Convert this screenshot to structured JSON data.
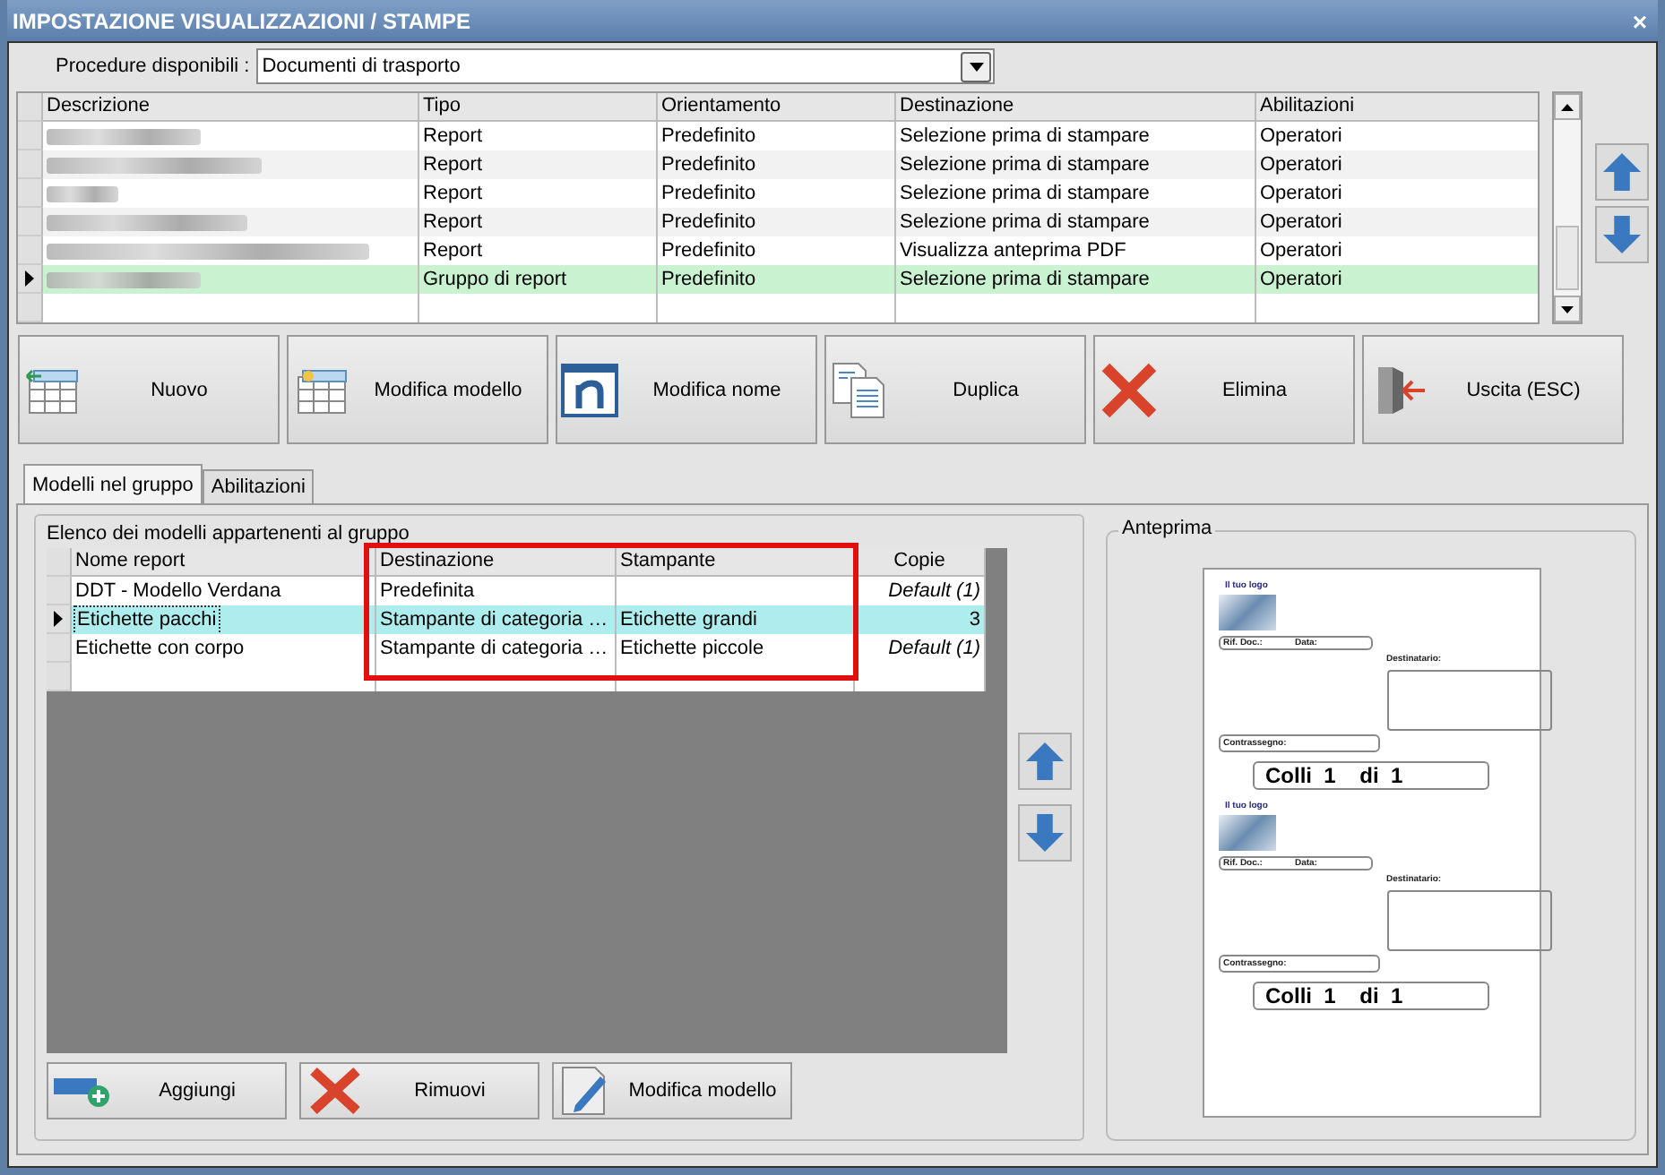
{
  "window": {
    "title": "IMPOSTAZIONE VISUALIZZAZIONI / STAMPE",
    "close": "×"
  },
  "procedure": {
    "label": "Procedure disponibili :",
    "value": "Documenti di trasporto"
  },
  "reports": {
    "columns": [
      "Descrizione",
      "Tipo",
      "Orientamento",
      "Destinazione",
      "Abilitazioni"
    ],
    "rows": [
      {
        "selected": false,
        "tipo": "Report",
        "orientamento": "Predefinito",
        "destinazione": "Selezione prima di stampare",
        "abilitazioni": "Operatori"
      },
      {
        "selected": false,
        "tipo": "Report",
        "orientamento": "Predefinito",
        "destinazione": "Selezione prima di stampare",
        "abilitazioni": "Operatori"
      },
      {
        "selected": false,
        "tipo": "Report",
        "orientamento": "Predefinito",
        "destinazione": "Selezione prima di stampare",
        "abilitazioni": "Operatori"
      },
      {
        "selected": false,
        "tipo": "Report",
        "orientamento": "Predefinito",
        "destinazione": "Selezione prima di stampare",
        "abilitazioni": "Operatori"
      },
      {
        "selected": false,
        "tipo": "Report",
        "orientamento": "Predefinito",
        "destinazione": "Visualizza anteprima PDF",
        "abilitazioni": "Operatori"
      },
      {
        "selected": true,
        "tipo": "Gruppo di report",
        "orientamento": "Predefinito",
        "destinazione": "Selezione prima di stampare",
        "abilitazioni": "Operatori"
      }
    ]
  },
  "toolbar": [
    {
      "kind": "new",
      "label": "Nuovo"
    },
    {
      "kind": "edit-model",
      "label": "Modifica modello"
    },
    {
      "kind": "rename",
      "label": "Modifica nome"
    },
    {
      "kind": "duplicate",
      "label": "Duplica"
    },
    {
      "kind": "delete",
      "label": "Elimina"
    },
    {
      "kind": "exit",
      "label": "Uscita (ESC)"
    }
  ],
  "tabs": [
    {
      "label": "Modelli nel gruppo",
      "selected": true
    },
    {
      "label": "Abilitazioni",
      "selected": false
    }
  ],
  "models": {
    "caption": "Elenco dei modelli appartenenti al gruppo",
    "columns": [
      "Nome report",
      "Destinazione",
      "Stampante",
      "Copie"
    ],
    "rows": [
      {
        "selected": false,
        "nome": "DDT - Modello Verdana",
        "destinazione": "Predefinita",
        "stampante": "",
        "copie": "Default (1)",
        "is_default": true
      },
      {
        "selected": true,
        "nome": "Etichette pacchi",
        "destinazione": "Stampante di categoria …",
        "stampante": "Etichette grandi",
        "copie": "3",
        "is_default": false
      },
      {
        "selected": false,
        "nome": "Etichette con corpo",
        "destinazione": "Stampante di categoria …",
        "stampante": "Etichette piccole",
        "copie": "Default (1)",
        "is_default": true
      }
    ]
  },
  "model_buttons": [
    {
      "kind": "add",
      "label": "Aggiungi"
    },
    {
      "kind": "delete",
      "label": "Rimuovi"
    },
    {
      "kind": "edit",
      "label": "Modifica modello"
    }
  ],
  "preview": {
    "title": "Anteprima",
    "labels": [
      {
        "logo": "Il tuo logo",
        "doc_ref": "Rif. Doc.:",
        "date": "Data:",
        "recipient": "Destinatario:",
        "cod": "Contrassegno:",
        "parcels": "Colli  1    di  1"
      },
      {
        "logo": "Il tuo logo",
        "doc_ref": "Rif. Doc.:",
        "date": "Data:",
        "recipient": "Destinatario:",
        "cod": "Contrassegno:",
        "parcels": "Colli  1    di  1"
      }
    ]
  }
}
